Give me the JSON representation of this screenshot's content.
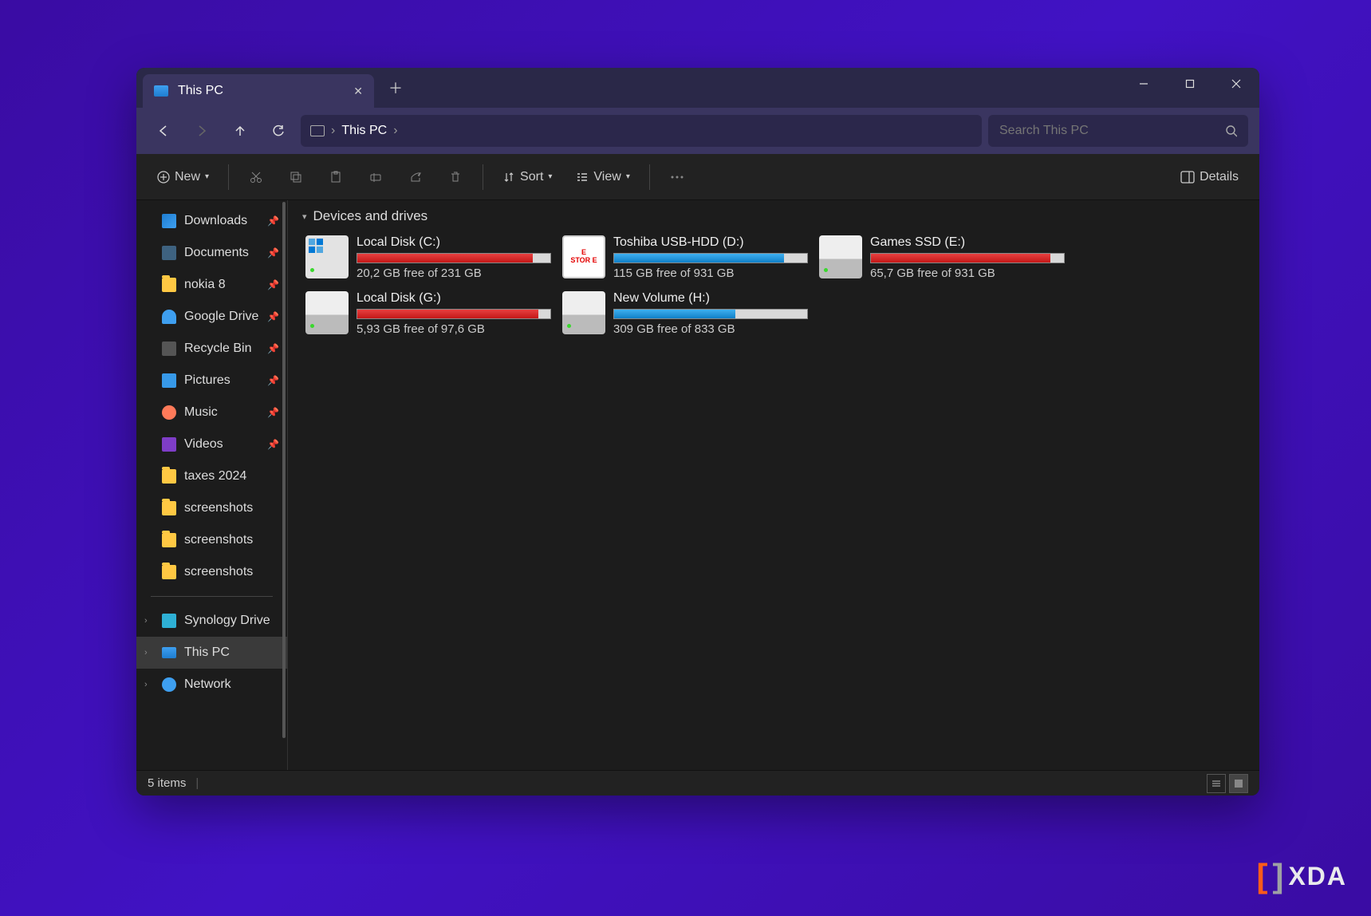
{
  "tab": {
    "title": "This PC"
  },
  "address": {
    "location": "This PC"
  },
  "search": {
    "placeholder": "Search This PC"
  },
  "toolbar": {
    "new": "New",
    "sort": "Sort",
    "view": "View",
    "details": "Details"
  },
  "sidebar": {
    "quick": [
      {
        "label": "Downloads",
        "icon": "download-ic",
        "pinned": true
      },
      {
        "label": "Documents",
        "icon": "doc-ic",
        "pinned": true
      },
      {
        "label": "nokia 8",
        "icon": "folder-ic",
        "pinned": true
      },
      {
        "label": "Google Drive",
        "icon": "cloud-ic",
        "pinned": true
      },
      {
        "label": "Recycle Bin",
        "icon": "bin-ic",
        "pinned": true
      },
      {
        "label": "Pictures",
        "icon": "pic-ic",
        "pinned": true
      },
      {
        "label": "Music",
        "icon": "music-ic",
        "pinned": true
      },
      {
        "label": "Videos",
        "icon": "video-ic",
        "pinned": true
      },
      {
        "label": "taxes 2024",
        "icon": "folder-ic",
        "pinned": false
      },
      {
        "label": "screenshots",
        "icon": "folder-ic",
        "pinned": false
      },
      {
        "label": "screenshots",
        "icon": "folder-ic",
        "pinned": false
      },
      {
        "label": "screenshots",
        "icon": "folder-ic",
        "pinned": false
      }
    ],
    "tree": [
      {
        "label": "Synology Drive",
        "icon": "drive-ic",
        "selected": false,
        "expandable": true
      },
      {
        "label": "This PC",
        "icon": "pc-ic",
        "selected": true,
        "expandable": true
      },
      {
        "label": "Network",
        "icon": "net-ic",
        "selected": false,
        "expandable": true
      }
    ]
  },
  "group_header": "Devices and drives",
  "drives": [
    {
      "name": "Local Disk (C:)",
      "free": "20,2 GB free of 231 GB",
      "pct": 91,
      "color": "red",
      "icon": "win"
    },
    {
      "name": "Toshiba USB-HDD (D:)",
      "free": "115 GB free of 931 GB",
      "pct": 88,
      "color": "blue",
      "icon": "estore"
    },
    {
      "name": "Games SSD (E:)",
      "free": "65,7 GB free of 931 GB",
      "pct": 93,
      "color": "red",
      "icon": "hdd"
    },
    {
      "name": "Local Disk (G:)",
      "free": "5,93 GB free of 97,6 GB",
      "pct": 94,
      "color": "red",
      "icon": "hdd"
    },
    {
      "name": "New Volume (H:)",
      "free": "309 GB free of 833 GB",
      "pct": 63,
      "color": "blue",
      "icon": "hdd"
    }
  ],
  "status": {
    "items": "5 items"
  },
  "watermark": "XDA"
}
